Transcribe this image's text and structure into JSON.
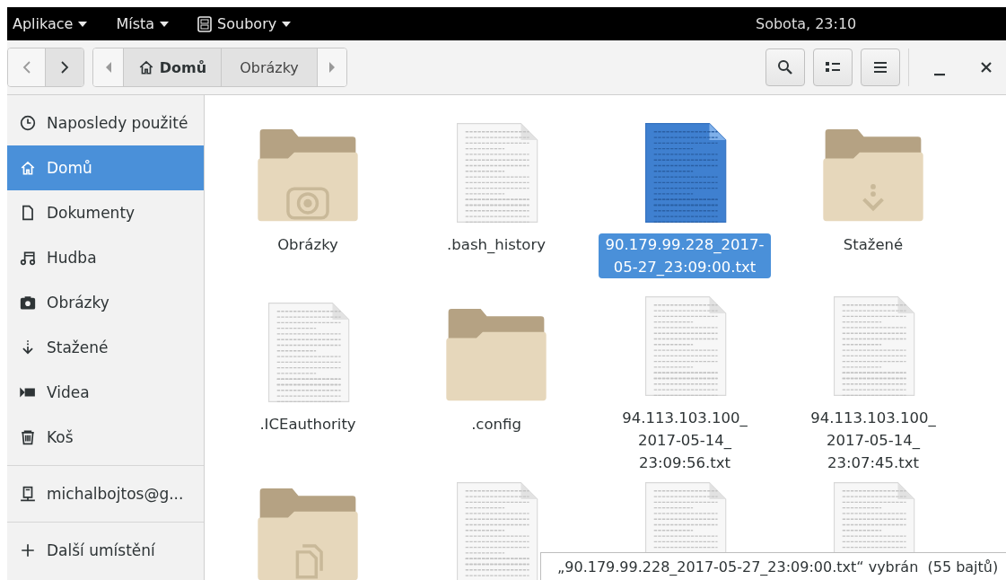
{
  "top_bar": {
    "menus": [
      {
        "label": "Aplikace",
        "icon": false
      },
      {
        "label": "Místa",
        "icon": false
      },
      {
        "label": "Soubory",
        "icon": true
      }
    ],
    "clock": "Sobota, 23:10"
  },
  "toolbar": {
    "back": {
      "disabled": true
    },
    "forward": {
      "disabled": false
    },
    "path": [
      {
        "label": "Domů",
        "kind": "home",
        "selected": true
      },
      {
        "label": "Obrázky",
        "kind": "folder",
        "selected": false
      }
    ]
  },
  "sidebar": {
    "groups": [
      [
        {
          "label": "Naposledy použité",
          "kind": "recent",
          "selected": false
        },
        {
          "label": "Domů",
          "kind": "home",
          "selected": true
        },
        {
          "label": "Dokumenty",
          "kind": "document",
          "selected": false
        },
        {
          "label": "Hudba",
          "kind": "music",
          "selected": false
        },
        {
          "label": "Obrázky",
          "kind": "camera",
          "selected": false
        },
        {
          "label": "Stažené",
          "kind": "download",
          "selected": false
        },
        {
          "label": "Videa",
          "kind": "video",
          "selected": false
        },
        {
          "label": "Koš",
          "kind": "trash",
          "selected": false
        }
      ],
      [
        {
          "label": "michalbojtos@g...",
          "kind": "computer",
          "selected": false
        }
      ],
      [
        {
          "label": "Další umístění",
          "kind": "add",
          "selected": false
        }
      ]
    ]
  },
  "files": [
    {
      "name": "Obrázky",
      "kind": "pictures-folder",
      "selected": false
    },
    {
      "name": ".bash_history",
      "kind": "text",
      "selected": false
    },
    {
      "name": "90.179.99.228_2017-05-27_23:09:00.txt",
      "kind": "text",
      "selected": true
    },
    {
      "name": "Stažené",
      "kind": "downloads-folder",
      "selected": false
    },
    {
      "name": ".ICEauthority",
      "kind": "text",
      "selected": false
    },
    {
      "name": ".config",
      "kind": "folder",
      "selected": false
    },
    {
      "name": "94.113.103.100_2017-05-14_23:09:56.txt",
      "kind": "text",
      "selected": false
    },
    {
      "name": "94.113.103.100_2017-05-14_23:07:45.txt",
      "kind": "text",
      "selected": false
    },
    {
      "kind": "templates-folder",
      "selected": false
    },
    {
      "kind": "text",
      "selected": false
    },
    {
      "kind": "text",
      "selected": false
    },
    {
      "kind": "text",
      "selected": false
    }
  ],
  "status": "„90.179.99.228_2017-05-27_23:09:00.txt“ vybrán  (55 bajtů)"
}
